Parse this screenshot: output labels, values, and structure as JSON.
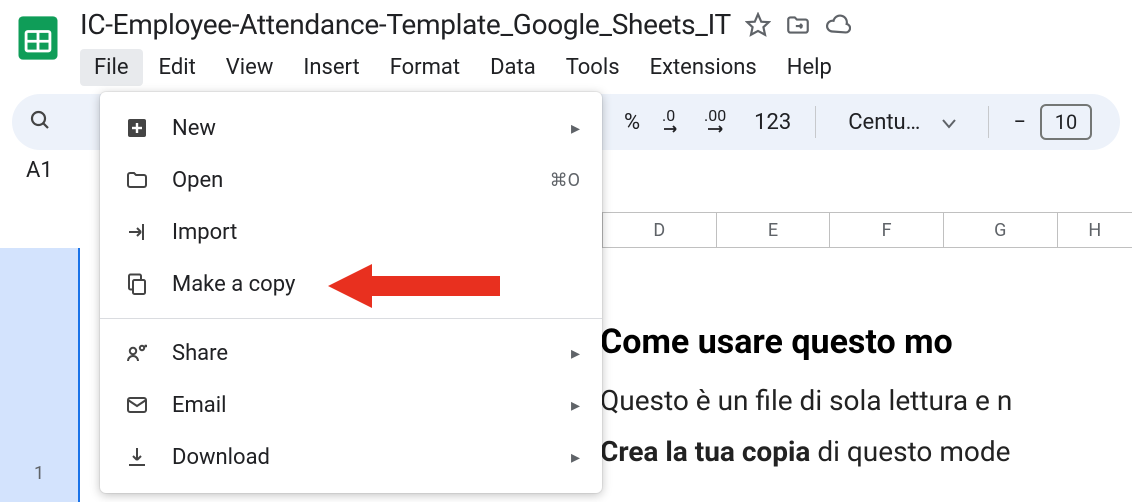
{
  "doc": {
    "title": "IC-Employee-Attendance-Template_Google_Sheets_IT"
  },
  "menubar": [
    "File",
    "Edit",
    "View",
    "Insert",
    "Format",
    "Data",
    "Tools",
    "Extensions",
    "Help"
  ],
  "toolbar": {
    "percent": "%",
    "dec_dec": ".0",
    "dec_inc": ".00",
    "num_fmt": "123",
    "font": "Centu…",
    "size_minus": "−",
    "size": "10"
  },
  "cell_ref": "A1",
  "columns": [
    "D",
    "E",
    "F",
    "G",
    "H"
  ],
  "row1": "1",
  "content": {
    "heading": "Come usare questo mo",
    "line1": "Questo è un file di sola lettura e n",
    "line2_bold": "Crea la tua copia",
    "line2_rest": " di questo mode"
  },
  "menu": {
    "new": "New",
    "open": "Open",
    "open_sc": "⌘O",
    "import": "Import",
    "copy": "Make a copy",
    "share": "Share",
    "email": "Email",
    "download": "Download"
  }
}
